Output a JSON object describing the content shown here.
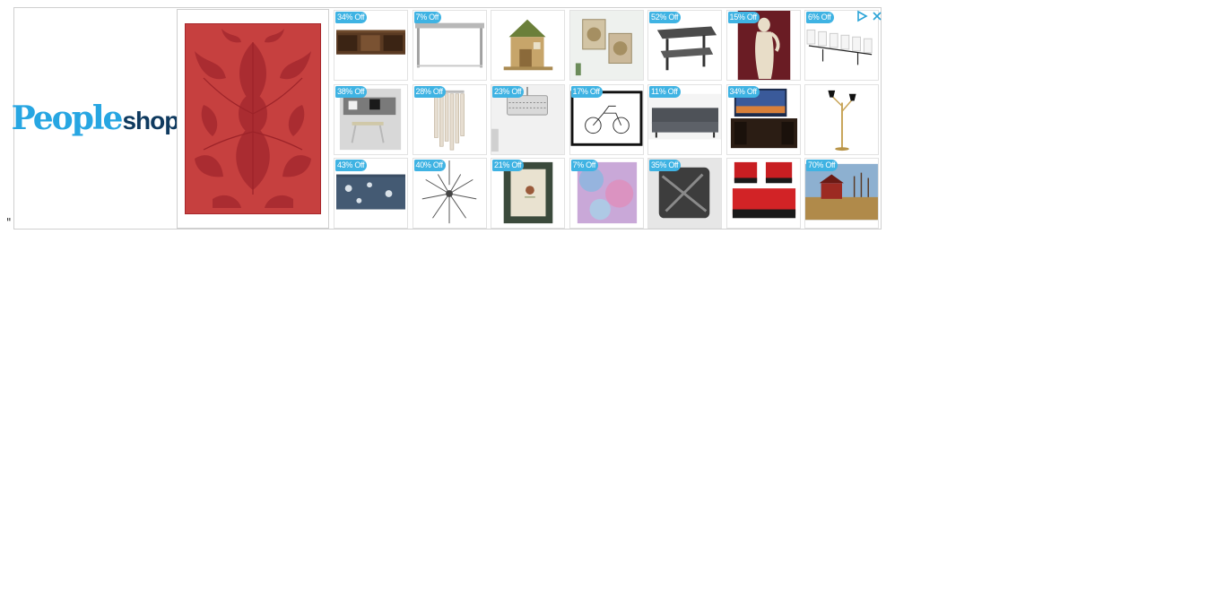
{
  "stray": {
    "quote": "\""
  },
  "brand": {
    "people": "People",
    "shop": "shop"
  },
  "colors": {
    "badge": "#3fb3e3",
    "brand_blue": "#27a6e2",
    "brand_navy": "#0f3a5f",
    "rug_red": "#c23a3d"
  },
  "icons": {
    "adchoices": "adchoices-triangle-icon",
    "close": "close-x-icon"
  },
  "products": [
    {
      "badge": "34% Off"
    },
    {
      "badge": "7% Off"
    },
    {
      "badge": ""
    },
    {
      "badge": ""
    },
    {
      "badge": "52% Off"
    },
    {
      "badge": "15% Off"
    },
    {
      "badge": "6% Off"
    },
    {
      "badge": "38% Off"
    },
    {
      "badge": "28% Off"
    },
    {
      "badge": "23% Off"
    },
    {
      "badge": "17% Off"
    },
    {
      "badge": "11% Off"
    },
    {
      "badge": "34% Off"
    },
    {
      "badge": ""
    },
    {
      "badge": "43% Off"
    },
    {
      "badge": "40% Off"
    },
    {
      "badge": "21% Off"
    },
    {
      "badge": "7% Off"
    },
    {
      "badge": "35% Off"
    },
    {
      "badge": ""
    },
    {
      "badge": "70% Off"
    }
  ]
}
